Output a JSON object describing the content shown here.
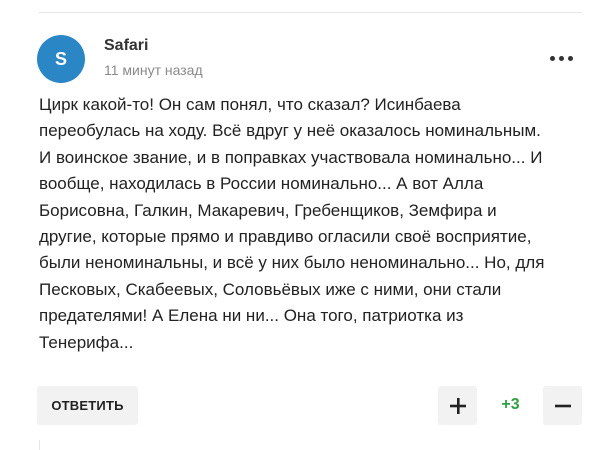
{
  "comment": {
    "avatar_letter": "S",
    "avatar_color": "#2b86c5",
    "author": "Safari",
    "time": "11 минут назад",
    "text": "Цирк какой-то! Он сам понял, что сказал? Исинбаева\nпереобулась на ходу. Всё вдруг у неё оказалось номинальным.\nИ воинское звание, и в поправках участвовала номинально... И\nвообще, находилась в России номинально... А вот Алла\nБорисовна, Галкин, Макаревич, Гребенщиков, Земфира и\nдругие, которые прямо и правдиво огласили своё восприятие,\nбыли неноминальны, и всё у них было неноминально... Но, для\nПесковых, Скабеевых, Соловьёвых иже с ними, они стали\nпредателями! А Елена ни ни... Она того, патриотка из\nТенерифа...",
    "more_icon": "more-horizontal-icon"
  },
  "actions": {
    "reply_label": "ОТВЕТИТЬ",
    "upvote_icon": "plus-icon",
    "downvote_icon": "minus-icon",
    "score": "+3",
    "score_color": "#2ea043"
  }
}
